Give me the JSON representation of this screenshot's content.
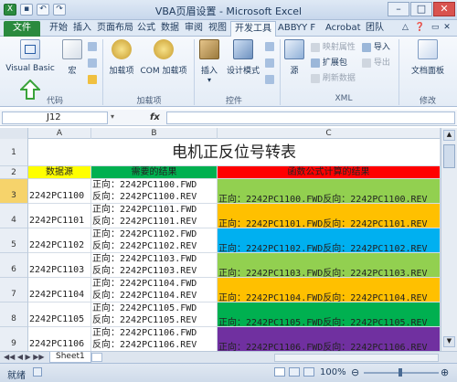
{
  "window": {
    "title": "VBA页眉设置 - Microsoft Excel",
    "qat": [
      "save",
      "undo",
      "redo"
    ]
  },
  "tabs": [
    "文件",
    "开始",
    "插入",
    "页面布局",
    "公式",
    "数据",
    "审阅",
    "视图",
    "开发工具",
    "ABBYY F",
    "Acrobat",
    "团队"
  ],
  "ribbon": {
    "groups": {
      "code": "代码",
      "addins": "加载项",
      "controls": "控件",
      "xml": "XML",
      "modify": "修改"
    },
    "buttons": {
      "visual_basic": "Visual Basic",
      "macros": "宏",
      "addins": "加载项",
      "com_addins": "COM 加载项",
      "insert": "插入",
      "design_mode": "设计模式",
      "source": "源",
      "map_properties": "映射属性",
      "expansion_packs": "扩展包",
      "refresh_data": "刷新数据",
      "import": "导入",
      "export": "导出",
      "doc_panel": "文档面板"
    }
  },
  "formula_bar": {
    "name_box": "J12",
    "fx": "fx",
    "formula": ""
  },
  "columns": [
    "A",
    "B",
    "C"
  ],
  "sheet": {
    "title": "电机正反位号转表",
    "headers": {
      "a": "数据源",
      "b": "需要的结果",
      "c": "函数公式计算的结果"
    },
    "rows": [
      {
        "num": "3",
        "a": "2242PC1100",
        "b1": "正向：2242PC1100.FWD",
        "b2": "反向：2242PC1100.REV",
        "c": "正向：2242PC1100.FWD反向：2242PC1100.REV",
        "color": "#92d050"
      },
      {
        "num": "4",
        "a": "2242PC1101",
        "b1": "正向：2242PC1101.FWD",
        "b2": "反向：2242PC1101.REV",
        "c": "正向：2242PC1101.FWD反向：2242PC1101.REV",
        "color": "#ffc000"
      },
      {
        "num": "5",
        "a": "2242PC1102",
        "b1": "正向：2242PC1102.FWD",
        "b2": "反向：2242PC1102.REV",
        "c": "正向：2242PC1102.FWD反向：2242PC1102.REV",
        "color": "#00b0f0"
      },
      {
        "num": "6",
        "a": "2242PC1103",
        "b1": "正向：2242PC1103.FWD",
        "b2": "反向：2242PC1103.REV",
        "c": "正向：2242PC1103.FWD反向：2242PC1103.REV",
        "color": "#92d050"
      },
      {
        "num": "7",
        "a": "2242PC1104",
        "b1": "正向：2242PC1104.FWD",
        "b2": "反向：2242PC1104.REV",
        "c": "正向：2242PC1104.FWD反向：2242PC1104.REV",
        "color": "#ffc000"
      },
      {
        "num": "8",
        "a": "2242PC1105",
        "b1": "正向：2242PC1105.FWD",
        "b2": "反向：2242PC1105.REV",
        "c": "正向：2242PC1105.FWD反向：2242PC1105.REV",
        "color": "#00b050"
      },
      {
        "num": "9",
        "a": "2242PC1106",
        "b1": "正向：2242PC1106.FWD",
        "b2": "反向：2242PC1106.REV",
        "c": "正向：2242PC1106.FWD反向：2242PC1106.REV",
        "color": "#7030a0"
      }
    ]
  },
  "sheet_tabs": [
    "Sheet1"
  ],
  "status": {
    "mode": "就绪",
    "zoom": "100%"
  },
  "colors": {
    "header_a": "#ffff00",
    "header_b": "#00b050",
    "header_c": "#ff0000",
    "row_num_highlight": "#f6d36b",
    "file_tab": "#2a8a3e"
  }
}
